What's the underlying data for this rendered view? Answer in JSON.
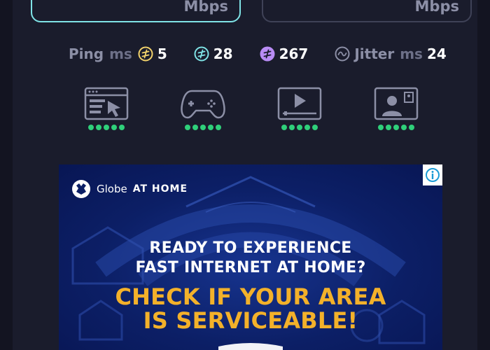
{
  "speed_boxes": {
    "download": {
      "unit": "Mbps"
    },
    "upload": {
      "unit": "Mbps"
    }
  },
  "stats": {
    "ping_label": "Ping",
    "ping_unit": "ms",
    "idle_value": "5",
    "download_value": "28",
    "upload_value": "267",
    "jitter_label": "Jitter",
    "jitter_unit": "ms",
    "jitter_value": "24"
  },
  "activities": [
    {
      "icon": "web-browsing-icon",
      "rating": 5
    },
    {
      "icon": "gaming-icon",
      "rating": 5
    },
    {
      "icon": "video-streaming-icon",
      "rating": 5
    },
    {
      "icon": "video-call-icon",
      "rating": 5
    }
  ],
  "ad": {
    "brand": "Globe",
    "brand_suffix": "AT HOME",
    "line1": "READY TO EXPERIENCE",
    "line2": "FAST INTERNET AT HOME?",
    "cta1": "CHECK IF YOUR AREA",
    "cta2": "IS SERVICEABLE!"
  },
  "colors": {
    "background": "#1a1c2c",
    "download_accent": "#7fe3e6",
    "idle_ping": "#f2d26b",
    "download_ping": "#7fe3e6",
    "upload_ping": "#b98cf5",
    "rating_dot": "#2fd07a",
    "ad_cta": "#f3b12a"
  }
}
